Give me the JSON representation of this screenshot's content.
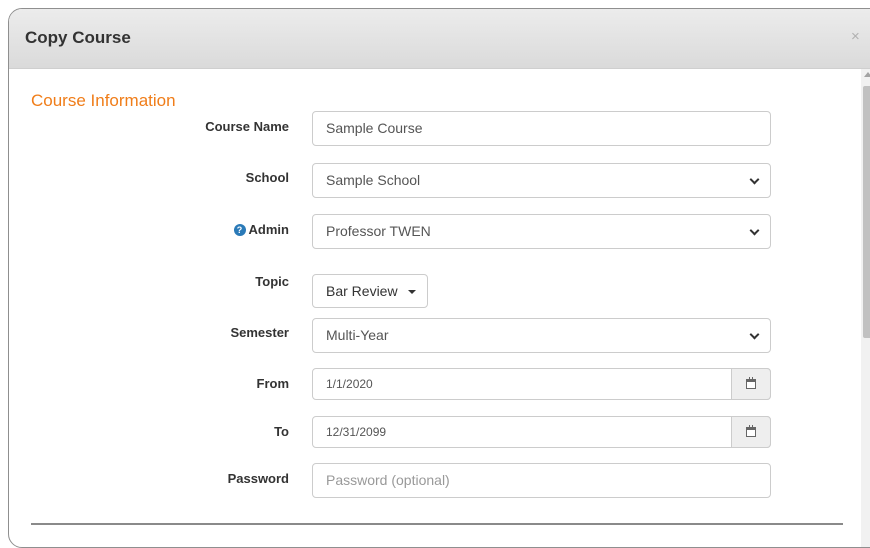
{
  "dialog": {
    "title": "Copy Course",
    "close_glyph": "×"
  },
  "section": {
    "title": "Course Information"
  },
  "fields": {
    "course_name": {
      "label": "Course Name",
      "value": "Sample Course"
    },
    "school": {
      "label": "School",
      "value": "Sample School"
    },
    "admin": {
      "label": "Admin",
      "value": "Professor TWEN",
      "help_glyph": "?"
    },
    "topic": {
      "label": "Topic",
      "value": "Bar Review"
    },
    "semester": {
      "label": "Semester",
      "value": "Multi-Year"
    },
    "from": {
      "label": "From",
      "value": "1/1/2020"
    },
    "to": {
      "label": "To",
      "value": "12/31/2099"
    },
    "password": {
      "label": "Password",
      "placeholder": "Password (optional)"
    }
  },
  "colors": {
    "accent": "#f07d19",
    "help_icon": "#2a7ab8"
  }
}
